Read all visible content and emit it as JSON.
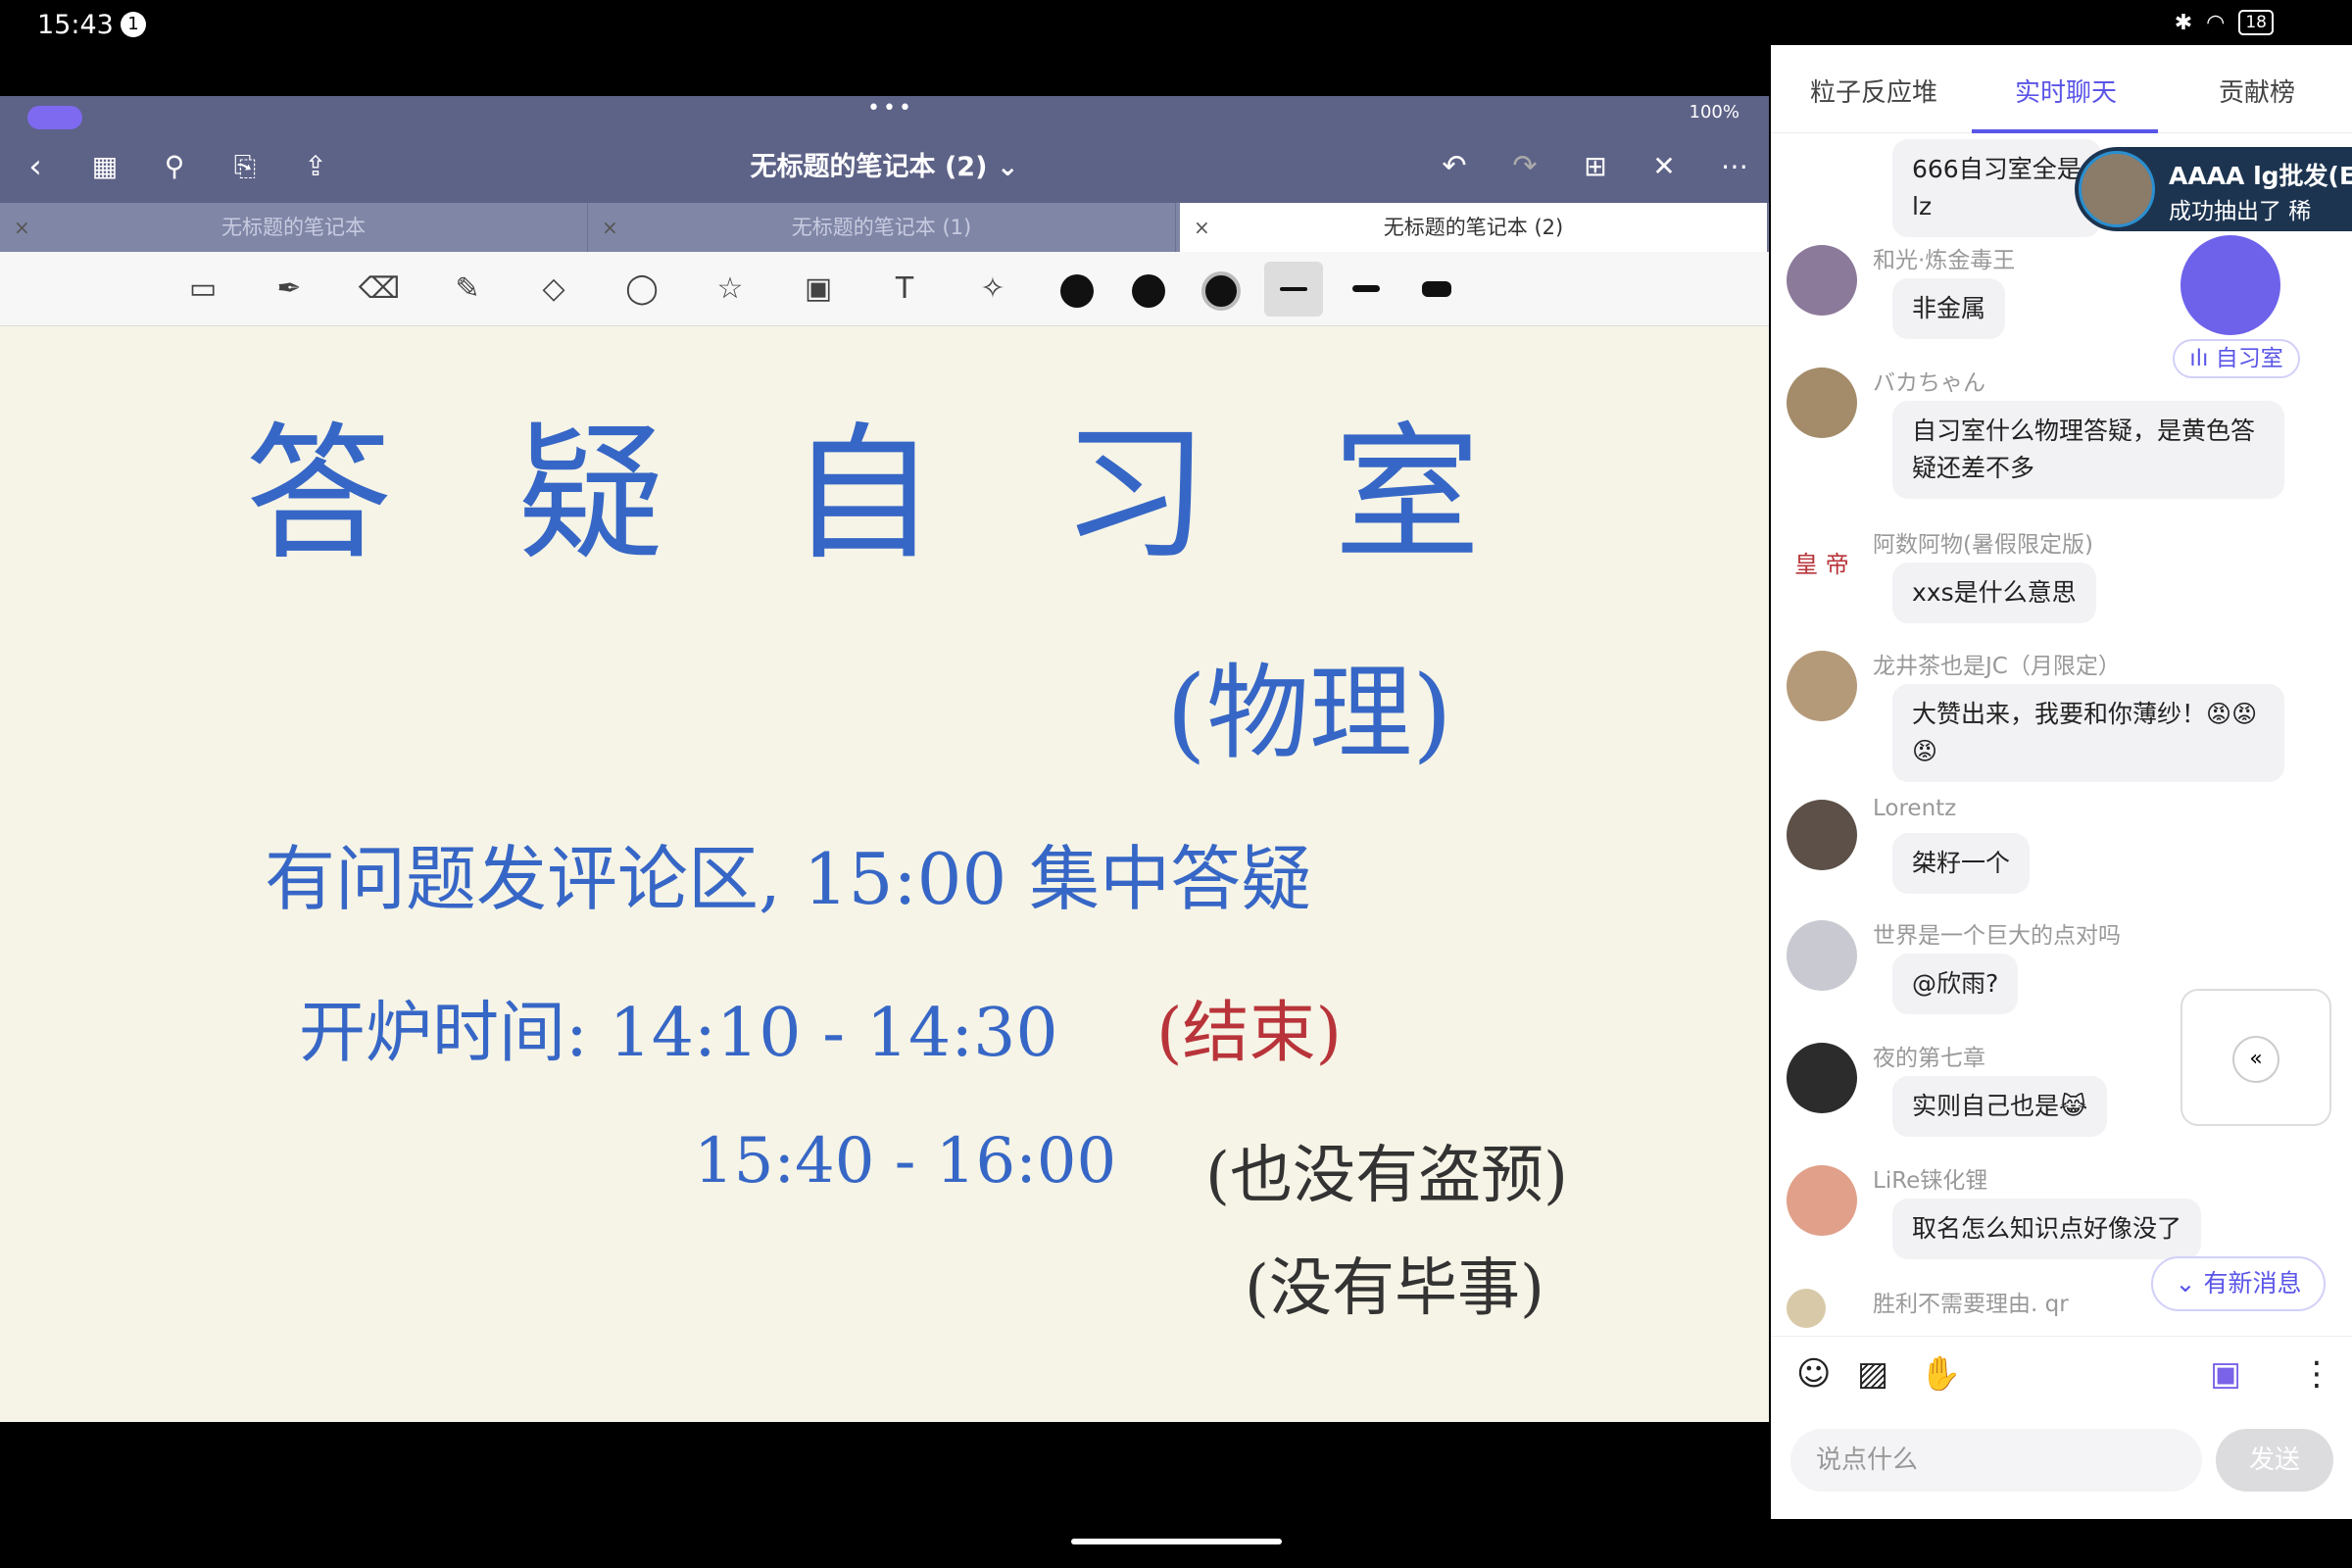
{
  "status_bar": {
    "time": "15:43",
    "notification": "1",
    "battery": "18"
  },
  "notebook": {
    "ipad_status": "100%",
    "title": "无标题的笔记本 (2) ⌄",
    "tabs": [
      {
        "label": "无标题的笔记本"
      },
      {
        "label": "无标题的笔记本 (1)"
      },
      {
        "label": "无标题的笔记本 (2)"
      }
    ],
    "handwriting": {
      "line1": "答 疑 自 习 室",
      "line2": "(物理)",
      "line3": "有问题发评论区, 15:00 集中答疑",
      "line4a": "开炉时间: 14:10 - 14:30",
      "line4b": "(结束)",
      "line5a": "15:40 - 16:00",
      "line5b": "(也没有盗预)",
      "line6": "(没有毕事)"
    }
  },
  "chat": {
    "tabs": [
      "粒子反应堆",
      "实时聊天",
      "贡献榜"
    ],
    "toast": {
      "title": "AAAA lg批发(E",
      "subtitle": "成功抽出了 稀"
    },
    "study_room_label": "ılı 自习室",
    "messages": [
      {
        "user": "",
        "text": "666自习室全是\nlz"
      },
      {
        "user": "和光·炼金毒王",
        "text": "非金属"
      },
      {
        "user": "バカちゃん",
        "text": "自习室什么物理答疑，是黄色答\n疑还差不多"
      },
      {
        "user": "阿数阿物(暑假限定版)",
        "text": "xxs是什么意思"
      },
      {
        "user": "龙井茶也是JC（月限定）",
        "text": "大赞出来，我要和你薄纱！😡😡\n😡"
      },
      {
        "user": "Lorentz",
        "text": "桀籽一个"
      },
      {
        "user": "世界是一个巨大的点对吗",
        "text": "@欣雨?"
      },
      {
        "user": "夜的第七章",
        "text": "实则自己也是😹"
      },
      {
        "user": "LiRe铼化锂",
        "text": "取名怎么知识点好像没了"
      },
      {
        "user": "胜利不需要理由. qr",
        "text": ""
      }
    ],
    "avatar_text": "皇 帝",
    "new_messages": "⌄ 有新消息",
    "input_placeholder": "说点什么",
    "send": "发送"
  }
}
